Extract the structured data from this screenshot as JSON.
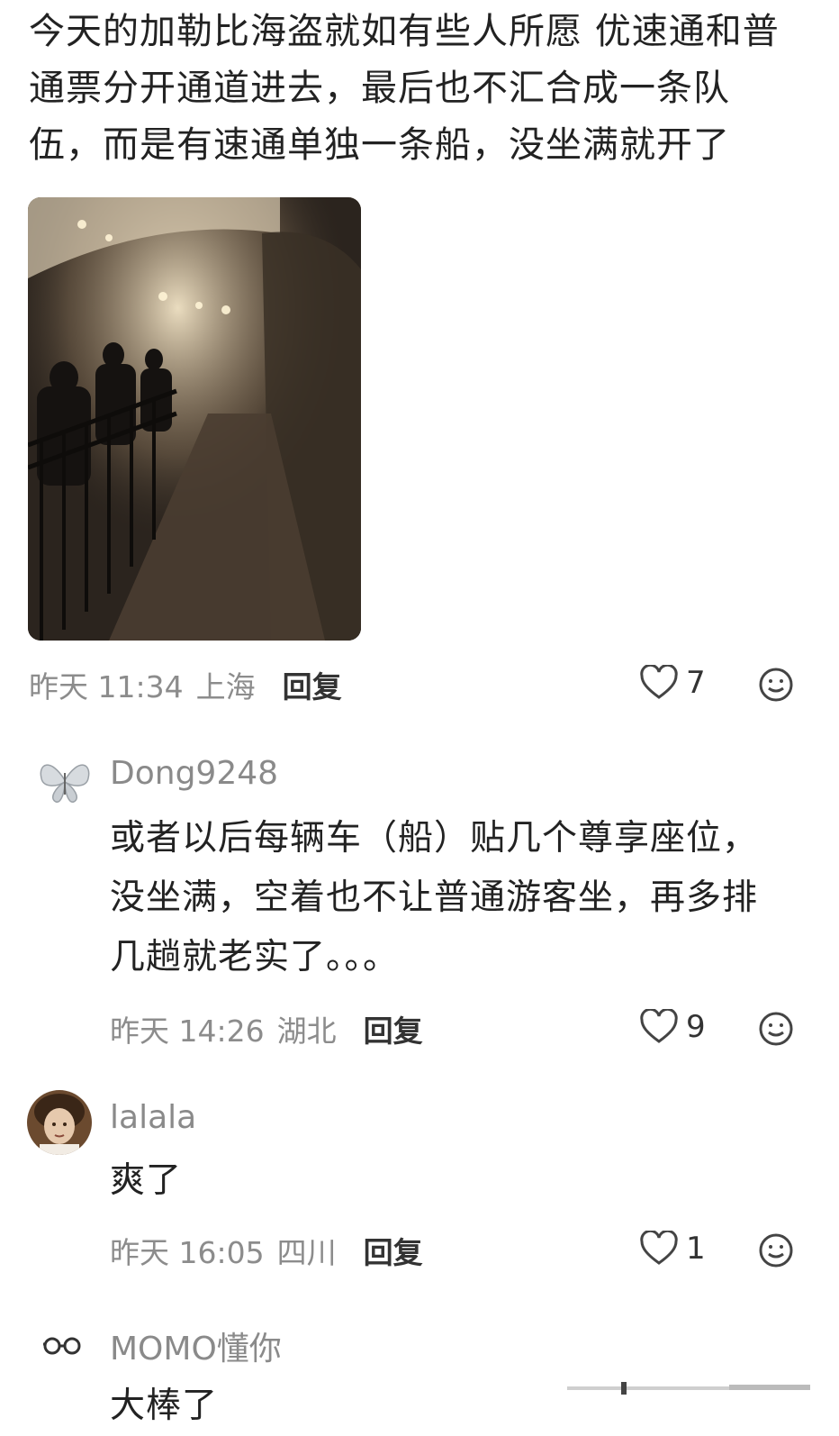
{
  "post": {
    "lines": [
      "今天的加勒比海盗就如有些人所愿 优速通和普",
      "通票分开通道进去，最后也不汇合成一条队",
      "伍，而是有速通单独一条船，没坐满就开了"
    ],
    "time": "昨天 11:34",
    "location": "上海",
    "reply_label": "回复",
    "likes": "7"
  },
  "comments": [
    {
      "username": "Dong9248",
      "lines": [
        "或者以后每辆车（船）贴几个尊享座位，",
        "没坐满，空着也不让普通游客坐，再多排",
        "几趟就老实了。。。"
      ],
      "time": "昨天 14:26",
      "location": "湖北",
      "reply_label": "回复",
      "likes": "9"
    },
    {
      "username": "lalala",
      "lines": [
        "爽了"
      ],
      "time": "昨天 16:05",
      "location": "四川",
      "reply_label": "回复",
      "likes": "1"
    },
    {
      "username": "MOMO懂你",
      "lines": [
        "大棒了"
      ]
    }
  ],
  "colors": {
    "meta": "#8c8c8c",
    "text": "#222222",
    "username": "#8a8a8a"
  },
  "icons": {
    "like": "heart-outline-icon",
    "react": "smile-icon"
  }
}
